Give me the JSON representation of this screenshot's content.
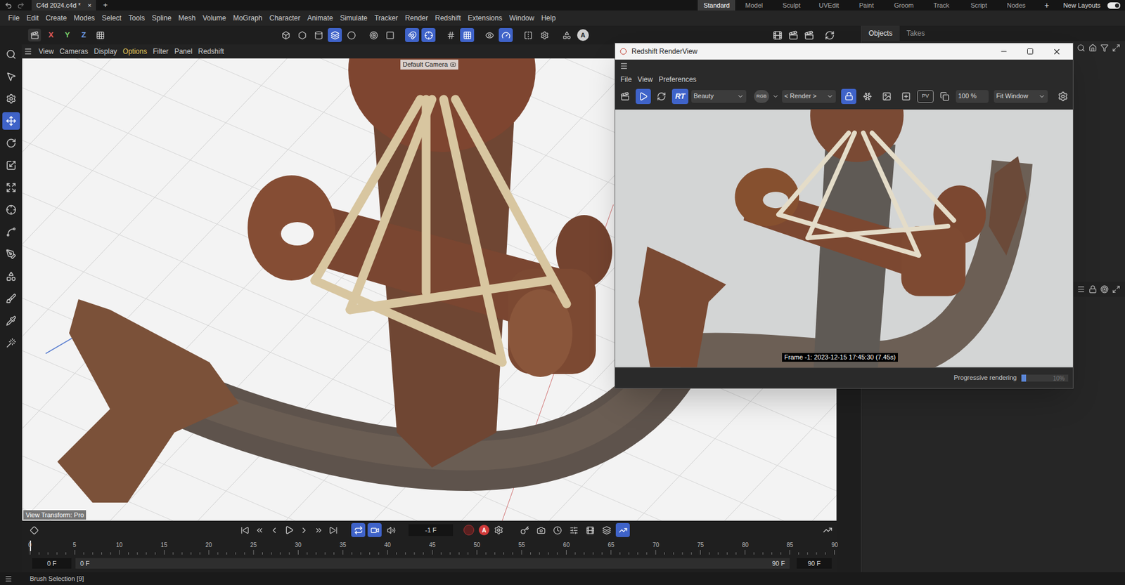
{
  "app": {
    "tab": "C4d 2024.c4d *",
    "tab_close": "×",
    "new_tab": "+"
  },
  "layouts": [
    {
      "label": "Standard",
      "selected": true
    },
    {
      "label": "Model",
      "selected": false
    },
    {
      "label": "Sculpt",
      "selected": false
    },
    {
      "label": "UVEdit",
      "selected": false
    },
    {
      "label": "Paint",
      "selected": false
    },
    {
      "label": "Groom",
      "selected": false
    },
    {
      "label": "Track",
      "selected": false
    },
    {
      "label": "Script",
      "selected": false
    },
    {
      "label": "Nodes",
      "selected": false
    }
  ],
  "layout_add": "+",
  "new_layouts": {
    "label": "New Layouts",
    "on": true
  },
  "menu": [
    "File",
    "Edit",
    "Create",
    "Modes",
    "Select",
    "Tools",
    "Spline",
    "Mesh",
    "Volume",
    "MoGraph",
    "Character",
    "Animate",
    "Simulate",
    "Tracker",
    "Render",
    "Redshift",
    "Extensions",
    "Window",
    "Help"
  ],
  "toolbar": {
    "axes": [
      {
        "label": "X",
        "color": "#e05a5a"
      },
      {
        "label": "Y",
        "color": "#7ccf6a"
      },
      {
        "label": "Z",
        "color": "#6d9be8"
      }
    ],
    "buttons": [
      {
        "on": false
      },
      {
        "on": false
      },
      {
        "on": false
      },
      {
        "on": true
      },
      {
        "on": false
      },
      {
        "on": false
      },
      {
        "on": false
      },
      {
        "on": true
      },
      {
        "on": true
      },
      {
        "on": false
      },
      {
        "on": true
      },
      {
        "on": false
      },
      {
        "on": true
      },
      {
        "on": false
      },
      {
        "on": false
      },
      {
        "on": false
      }
    ],
    "mode_label": "A"
  },
  "tools": [
    {
      "selected": false
    },
    {
      "selected": false
    },
    {
      "selected": false
    },
    {
      "selected": true
    },
    {
      "selected": false
    },
    {
      "selected": false
    },
    {
      "selected": false
    },
    {
      "selected": false
    },
    {
      "selected": false
    },
    {
      "selected": false
    },
    {
      "selected": false
    },
    {
      "selected": false
    },
    {
      "selected": false
    },
    {
      "selected": false
    }
  ],
  "viewport": {
    "menu": [
      {
        "label": "View",
        "selected": false
      },
      {
        "label": "Cameras",
        "selected": false
      },
      {
        "label": "Display",
        "selected": false
      },
      {
        "label": "Options",
        "selected": true
      },
      {
        "label": "Filter",
        "selected": false
      },
      {
        "label": "Panel",
        "selected": false
      },
      {
        "label": "Redshift",
        "selected": false
      }
    ],
    "camera": "Default Camera",
    "view_transform": "View Transform: Pro"
  },
  "timeline": {
    "frame": "-1 F",
    "record_label": "A",
    "loop_buttons": [
      {
        "on": true
      },
      {
        "on": true
      },
      {
        "on": false
      }
    ],
    "key_buttons": [
      {
        "on": false
      },
      {
        "on": false
      },
      {
        "on": false
      },
      {
        "on": false
      },
      {
        "on": false
      },
      {
        "on": false
      },
      {
        "on": true
      }
    ],
    "ticks": [
      "0",
      "5",
      "10",
      "15",
      "20",
      "25",
      "30",
      "35",
      "40",
      "45",
      "50",
      "55",
      "60",
      "65",
      "70",
      "75",
      "80",
      "85",
      "90"
    ],
    "start": "0 F",
    "range_min": "0 F",
    "range_max": "90 F",
    "end": "90 F"
  },
  "objects_panel": {
    "tabs": [
      {
        "label": "Objects",
        "selected": true
      },
      {
        "label": "Takes",
        "selected": false
      }
    ]
  },
  "render_view": {
    "title": "Redshift RenderView",
    "menu": [
      "File",
      "View",
      "Preferences"
    ],
    "play_on": true,
    "rt": {
      "label": "RT",
      "on": true
    },
    "aov": "Beauty",
    "rgb": "RGB",
    "render": "< Render >",
    "lock_on": true,
    "pv": "PV",
    "zoom": "100 %",
    "fit": "Fit Window",
    "frame_info": "Frame -1: 2023-12-15 17:45:30 (7.45s)",
    "progress_label": "Progressive rendering",
    "progress_reading": "10%",
    "progress": 0.1
  },
  "status_bar": {
    "text": "Brush Selection [9]"
  }
}
